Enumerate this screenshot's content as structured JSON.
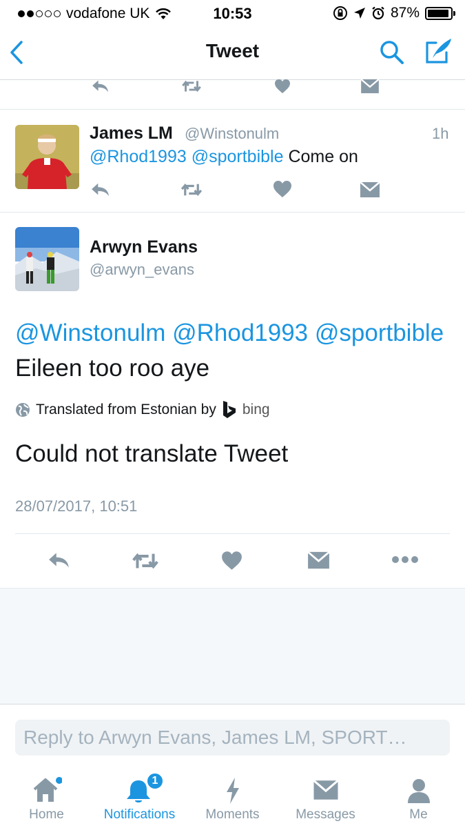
{
  "status_bar": {
    "carrier": "vodafone UK",
    "time": "10:53",
    "battery": "87%"
  },
  "nav": {
    "title": "Tweet"
  },
  "reply_tweet": {
    "name": "James LM",
    "handle": "@Winstonulm",
    "time": "1h",
    "mention1": "@Rhod1993",
    "mention2": "@sportbible",
    "text": "Come on"
  },
  "main_tweet": {
    "name": "Arwyn Evans",
    "handle": "@arwyn_evans",
    "mentions": "@Winstonulm @Rhod1993 @sportbible",
    "text": "Eileen too roo aye",
    "translated_label": "Translated from Estonian by",
    "bing": "bing",
    "translation": "Could not translate Tweet",
    "timestamp": "28/07/2017, 10:51"
  },
  "composer": {
    "placeholder": "Reply to Arwyn Evans, James LM, SPORT…"
  },
  "tabs": [
    {
      "label": "Home"
    },
    {
      "label": "Notifications",
      "badge": "1"
    },
    {
      "label": "Moments"
    },
    {
      "label": "Messages"
    },
    {
      "label": "Me"
    }
  ],
  "colors": {
    "accent": "#1b95e0",
    "icon_gray": "#8899a6"
  }
}
